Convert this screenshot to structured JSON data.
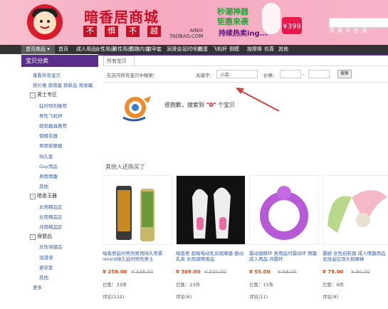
{
  "header": {
    "brand_title": "暗香居商城",
    "brand_tags": [
      "不",
      "惧",
      "不",
      "越"
    ],
    "brand_en_1": "AINIX",
    "brand_en_2": "TAOBAO.COM",
    "promo_line1": "秒潮神器",
    "promo_line2": "钜惠来袭",
    "promo_line3": "持续热卖ing...",
    "price_badge": "¥399",
    "search_caption": "收 藏 本 店 铺"
  },
  "nav": {
    "items": [
      "首页商品 ▾",
      "首页",
      "成人用品",
      "女性用品",
      "男性用品",
      "情趣内衣",
      "避孕套",
      "润滑油",
      "延时喷剂",
      "跳蛋",
      "飞机杯",
      "倒模",
      "按摩棒",
      "仿真",
      "其他"
    ]
  },
  "sidebar": {
    "title": "宝贝分类",
    "items": [
      {
        "label": "查看所有宝贝",
        "kind": "link",
        "indent": 0
      },
      {
        "label": "按价格 按销量 按新品 按收藏",
        "kind": "link",
        "indent": 0
      },
      {
        "label": "男士专区",
        "kind": "group"
      },
      {
        "label": "延时喷剂推荐",
        "kind": "link",
        "indent": 1
      },
      {
        "label": "男性飞机杯",
        "kind": "link",
        "indent": 1
      },
      {
        "label": "助勃器具推荐",
        "kind": "link",
        "indent": 1
      },
      {
        "label": "倒模名器",
        "kind": "link",
        "indent": 1
      },
      {
        "label": "男用按摩器",
        "kind": "link",
        "indent": 1
      },
      {
        "label": "持久套",
        "kind": "link",
        "indent": 1
      },
      {
        "label": "Gay用品",
        "kind": "link",
        "indent": 1
      },
      {
        "label": "男用情趣",
        "kind": "link",
        "indent": 1
      },
      {
        "label": "其他",
        "kind": "link",
        "indent": 1
      },
      {
        "label": "暗香玉器",
        "kind": "group"
      },
      {
        "label": "女用精品区",
        "kind": "link",
        "indent": 1
      },
      {
        "label": "女用精品区",
        "kind": "link",
        "indent": 1
      },
      {
        "label": "共用精品区",
        "kind": "link",
        "indent": 1
      },
      {
        "label": "保健品",
        "kind": "group"
      },
      {
        "label": "女性保健品",
        "kind": "link",
        "indent": 1
      },
      {
        "label": "润滑液",
        "kind": "link",
        "indent": 1
      },
      {
        "label": "避孕套",
        "kind": "link",
        "indent": 1
      },
      {
        "label": "其他",
        "kind": "link",
        "indent": 1
      },
      {
        "label": "更多",
        "kind": "link",
        "indent": 0
      }
    ]
  },
  "main": {
    "crumb": "所有宝贝",
    "filter_in_results": "在店内所有宝贝中搜索：",
    "keyword_label": "关键字：",
    "keyword_value": "小菲",
    "price_label": "价格：",
    "price_sep": "-",
    "search_button": "搜索",
    "not_found_prefix": "很抱歉，搜索到",
    "not_found_count": "0",
    "not_found_suffix": "个宝贝",
    "others_title": "其他人还购买了",
    "products": [
      {
        "name": "暗香居延时喷剂男用持久喷雾 retard持久延时喷剂男士",
        "price": "¥ 258.00",
        "old": "¥ 338.00",
        "sales": "已售：33件",
        "reviews": "评论(122)"
      },
      {
        "name": "暗香居 超级电动乳房按摩器 振动 乳夹 女用调情用品",
        "price": "¥ 309.00",
        "old": "¥ 500.00",
        "sales": "已售：23件",
        "reviews": "评论(6)"
      },
      {
        "name": "震动锁精环 男用延时震动环 情趣成人用品 共震环",
        "price": "¥ 55.00",
        "old": "¥ 68.00",
        "sales": "已售：15件",
        "reviews": "评论(11)"
      },
      {
        "name": "震撼 女性自慰器 成人情趣用品 无线遥控双头按摩棒",
        "price": "¥ 79.00",
        "old": "¥ 90.00",
        "sales": "已售：8件",
        "reviews": "评论(8)"
      }
    ]
  }
}
